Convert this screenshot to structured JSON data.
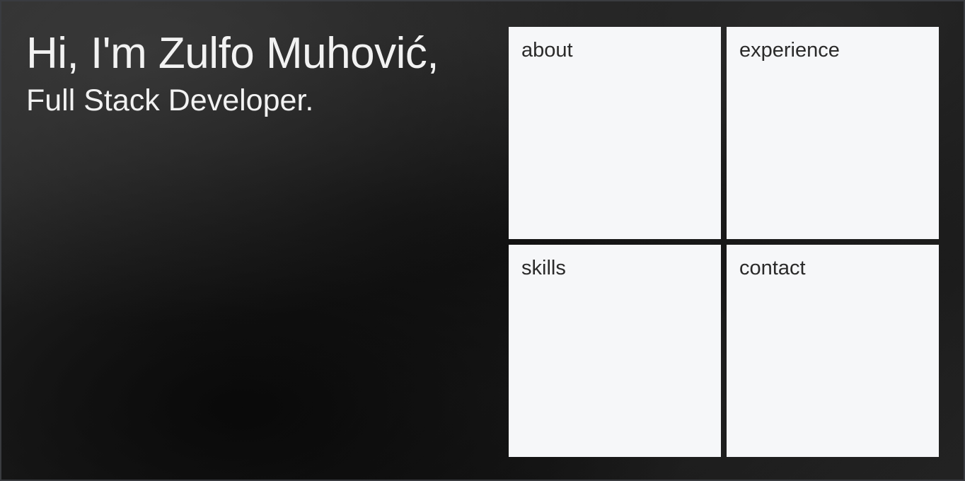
{
  "hero": {
    "headline": "Hi, I'm Zulfo Muhović,",
    "subtitle": "Full Stack Developer."
  },
  "nav_tiles": [
    {
      "label": "about"
    },
    {
      "label": "experience"
    },
    {
      "label": "skills"
    },
    {
      "label": "contact"
    }
  ],
  "colors": {
    "background": "#1a1a1a",
    "text": "#f2f2f2",
    "tile": "#f6f7f9",
    "tile_text": "#2a2a2a"
  }
}
